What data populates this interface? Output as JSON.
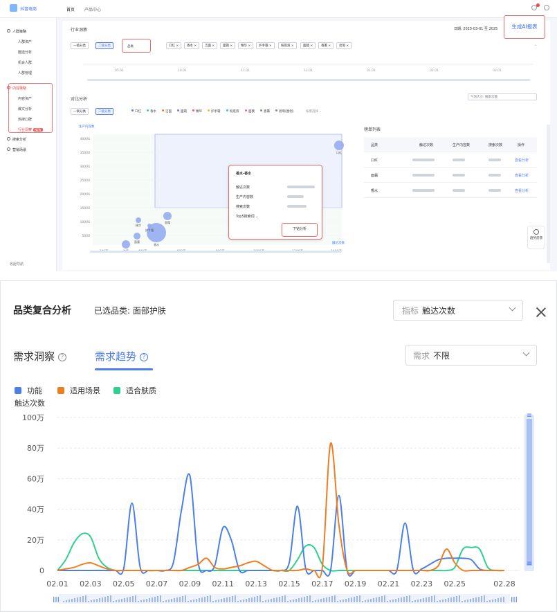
{
  "top_panel": {
    "logo": "抖音电商",
    "nav": [
      "首页",
      "产品中心"
    ],
    "header_date": "日期: 2025-03-01 至 2025",
    "ai_button": "生成AI报表",
    "sidebar": [
      {
        "label": "人群策略",
        "level": 1
      },
      {
        "label": "人群资产",
        "level": 2
      },
      {
        "label": "圈选分析",
        "level": 2
      },
      {
        "label": "机会人群",
        "level": 2
      },
      {
        "label": "人群管理",
        "level": 2
      },
      {
        "label": "内容策略",
        "level": 1,
        "red": true
      },
      {
        "label": "内容资产",
        "level": 2
      },
      {
        "label": "爆文分析",
        "level": 2
      },
      {
        "label": "热搜口碑",
        "level": 2
      },
      {
        "label": "行业洞察",
        "level": 2,
        "red": true,
        "tag": "NEW"
      },
      {
        "label": "搜索分析",
        "level": 1
      },
      {
        "label": "营销场景",
        "level": 1
      }
    ],
    "sidebar_footer": "收起导航",
    "page_title": "行业洞察",
    "filter_tabs": [
      "一级分类",
      "二级分类"
    ],
    "filter_select": "品类",
    "filter_chips": [
      "口红",
      "香水",
      "洁面",
      "面霜",
      "精华",
      "护手霜",
      "粉底液",
      "面膜",
      "香薰",
      "遮瑕"
    ],
    "range_labels": [
      "05.01",
      "10.01",
      "11.01",
      "12.01",
      "01.01",
      "02.01",
      "03.01"
    ],
    "section2_title": "对比分析",
    "section2_right_select": "气泡大小: 搜索次数",
    "section2_legend": [
      "口红",
      "香水",
      "洁面",
      "面霜",
      "精华",
      "护手霜",
      "粉底液",
      "面膜",
      "香薰",
      "遮瑕(图例)"
    ],
    "section2_more": "按需选择",
    "bubble_ylabel": "生产内容数",
    "bubble_y_ticks": [
      "40000",
      "35000",
      "30000",
      "25000",
      "20000",
      "15000",
      "10000",
      "5000"
    ],
    "bubble_x_ticks": [
      "200万",
      "400万",
      "600万",
      "800万",
      "1000万",
      "1200万",
      "1400万"
    ],
    "bubble_xlabel": "触达次数",
    "bubble_labels": [
      "口红",
      "面霜",
      "香水",
      "精华",
      "洁面",
      "面膜",
      "护手霜"
    ],
    "tooltip": {
      "title": "香水-香水",
      "rows": [
        "触达次数",
        "生产内容数",
        "搜索次数",
        "Top5搜索词"
      ],
      "button": "下钻分析"
    },
    "table_title": "榜单列表",
    "table_headers": [
      "品类",
      "触达次数",
      "生产内容数",
      "搜索次数",
      "操作"
    ],
    "table_rows": [
      {
        "name": "口红",
        "action": "查看分析"
      },
      {
        "name": "面霜",
        "action": "查看分析"
      },
      {
        "name": "香水",
        "action": "查看分析"
      }
    ],
    "float_button": "趋势反馈"
  },
  "bottom_panel": {
    "title": "品类复合分析",
    "selected_label": "已选品类: 面部护肤",
    "metric_dropdown": {
      "label": "指标",
      "value": "触达次数"
    },
    "demand_dropdown": {
      "label": "需求",
      "value": "不限"
    },
    "tabs": [
      {
        "label": "需求洞察",
        "active": false
      },
      {
        "label": "需求趋势",
        "active": true
      }
    ],
    "colors": {
      "blue": "#4a7fe8",
      "orange": "#f07c22",
      "green": "#2fd08e",
      "accent": "#4b7cf3"
    }
  },
  "chart_data": {
    "type": "line",
    "title": "",
    "xlabel": "",
    "ylabel": "触达次数",
    "ylim": [
      0,
      100
    ],
    "y_ticks": [
      "0",
      "20万",
      "40万",
      "60万",
      "80万",
      "100万"
    ],
    "x_tick_labels": [
      "02.01",
      "02.03",
      "02.05",
      "02.07",
      "02.09",
      "02.11",
      "02.13",
      "02.15",
      "02.17",
      "02.19",
      "02.21",
      "02.23",
      "02.25",
      "02.28"
    ],
    "x": [
      1,
      1.5,
      2,
      2.5,
      3,
      3.5,
      4,
      4.5,
      5,
      5.5,
      6,
      6.5,
      7,
      7.5,
      8,
      8.5,
      9,
      9.5,
      10,
      10.5,
      11,
      11.5,
      12,
      12.5,
      13,
      13.5,
      14,
      14.5,
      15,
      15.5,
      16,
      16.5,
      17,
      17.5,
      18,
      18.5,
      19,
      19.5,
      20,
      20.5,
      21,
      21.5,
      22,
      22.5,
      23,
      23.5,
      24,
      24.5,
      25,
      25.5,
      26,
      26.5,
      27,
      27.5,
      28
    ],
    "x_unit": "day of February",
    "grid": true,
    "legend_position": "top-left",
    "series": [
      {
        "name": "功能",
        "color": "#4a7fe8",
        "values": [
          0,
          0,
          0,
          0,
          0,
          0,
          0,
          0,
          1,
          44,
          2,
          0,
          0,
          0,
          5,
          40,
          62,
          5,
          0,
          3,
          28,
          20,
          0,
          0,
          0,
          0,
          0,
          0,
          5,
          42,
          1,
          0,
          0,
          0,
          49,
          0,
          0,
          0,
          0,
          0,
          0,
          0,
          31,
          0,
          1,
          4,
          7,
          8,
          8,
          8,
          7,
          1,
          0,
          0,
          0,
          5,
          24,
          6,
          2
        ]
      },
      {
        "name": "适用场景",
        "color": "#f07c22",
        "values": [
          0,
          1,
          2,
          4,
          5,
          3,
          1,
          0,
          0,
          0,
          0,
          0,
          0,
          0,
          0,
          0,
          2,
          4,
          8,
          2,
          1,
          2,
          3,
          5,
          6,
          3,
          0,
          0,
          0,
          0,
          1,
          0,
          2,
          83,
          30,
          0,
          0,
          0,
          0,
          0,
          0,
          0,
          0,
          0,
          0,
          0,
          3,
          14,
          5,
          0,
          0,
          0,
          0,
          0,
          0,
          0,
          10,
          12,
          5
        ]
      },
      {
        "name": "适合肤质",
        "color": "#2fd08e",
        "values": [
          0,
          7,
          18,
          24,
          22,
          8,
          2,
          0,
          0,
          0,
          0,
          0,
          0,
          0,
          0,
          0,
          0,
          0,
          0,
          0,
          0,
          0,
          0,
          0,
          0,
          0,
          0,
          0,
          0,
          7,
          16,
          15,
          4,
          0,
          0,
          0,
          0,
          0,
          0,
          0,
          0,
          0,
          0,
          0,
          0,
          0,
          0,
          0,
          2,
          14,
          15,
          14,
          2,
          0,
          0,
          0,
          0,
          0,
          0
        ]
      }
    ]
  }
}
